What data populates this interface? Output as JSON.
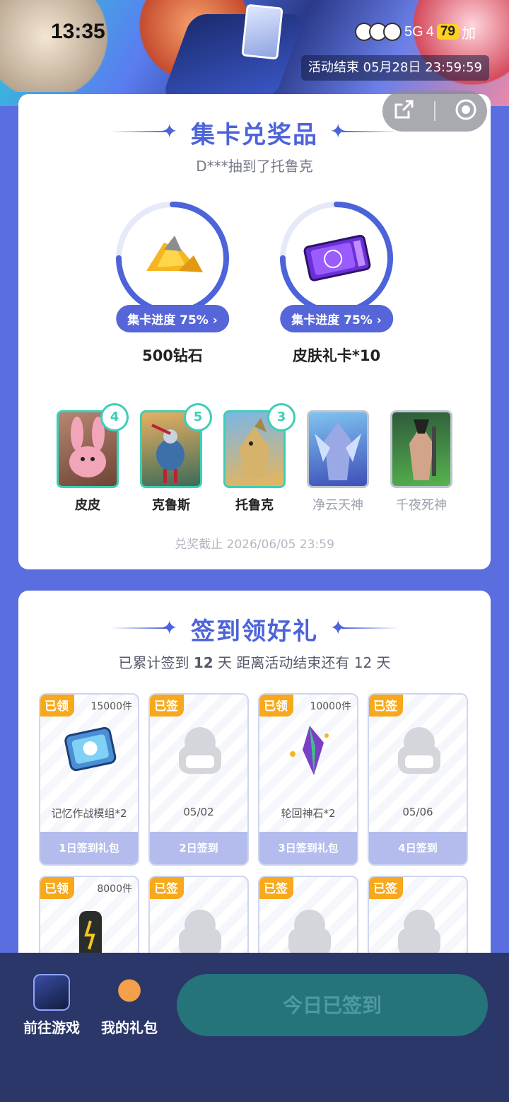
{
  "status_bar": {
    "time": "13:35",
    "network": "5G",
    "signal_suffix": "4",
    "battery": "79",
    "extra": "加"
  },
  "banner": {
    "event_end": "活动结束 05月28日 23:59:59"
  },
  "card_exchange": {
    "title": "集卡兑奖品",
    "broadcast": "D***抽到了托鲁克",
    "prizes": [
      {
        "name": "500钻石",
        "progress_label": "集卡进度 75%",
        "progress": 0.75,
        "icon": "diamond-pile-icon"
      },
      {
        "name": "皮肤礼卡*10",
        "progress_label": "集卡进度 75%",
        "progress": 0.75,
        "icon": "skin-card-icon"
      }
    ],
    "cards": [
      {
        "name": "皮皮",
        "count": "4",
        "owned": true
      },
      {
        "name": "克鲁斯",
        "count": "5",
        "owned": true
      },
      {
        "name": "托鲁克",
        "count": "3",
        "owned": true
      },
      {
        "name": "净云天神",
        "count": "",
        "owned": false
      },
      {
        "name": "千夜死神",
        "count": "",
        "owned": false
      }
    ],
    "deadline": "兑奖截止 2026/06/05 23:59"
  },
  "signin": {
    "title": "签到领好礼",
    "summary_prefix": "已累计签到",
    "days_signed": "12",
    "summary_mid": "天  距离活动结束还有",
    "days_left": "12",
    "summary_suffix": "天",
    "days": [
      {
        "tag": "已领",
        "qty": "15000件",
        "label": "记忆作战模组*2",
        "footer": "1日签到礼包",
        "icon": "memory-module-icon"
      },
      {
        "tag": "已签",
        "qty": "",
        "label": "05/02",
        "footer": "2日签到",
        "icon": "placeholder-avatar-icon"
      },
      {
        "tag": "已领",
        "qty": "10000件",
        "label": "轮回神石*2",
        "footer": "3日签到礼包",
        "icon": "crystal-icon"
      },
      {
        "tag": "已签",
        "qty": "",
        "label": "05/06",
        "footer": "4日签到",
        "icon": "placeholder-avatar-icon"
      },
      {
        "tag": "已领",
        "qty": "8000件",
        "label": "",
        "footer": "",
        "icon": "capsule-device-icon"
      },
      {
        "tag": "已签",
        "qty": "",
        "label": "",
        "footer": "",
        "icon": "placeholder-avatar-icon"
      },
      {
        "tag": "已签",
        "qty": "",
        "label": "",
        "footer": "",
        "icon": "placeholder-avatar-icon"
      },
      {
        "tag": "已签",
        "qty": "",
        "label": "",
        "footer": "",
        "icon": "placeholder-avatar-icon"
      }
    ]
  },
  "bottom_bar": {
    "go_game": "前往游戏",
    "my_gifts": "我的礼包",
    "cta": "今日已签到"
  },
  "colors": {
    "accent": "#4d63d9",
    "teal": "#3ccfb6",
    "tag_orange": "#f7a81b",
    "bottom_bg": "#2b3669",
    "cta_bg": "#24747a"
  }
}
